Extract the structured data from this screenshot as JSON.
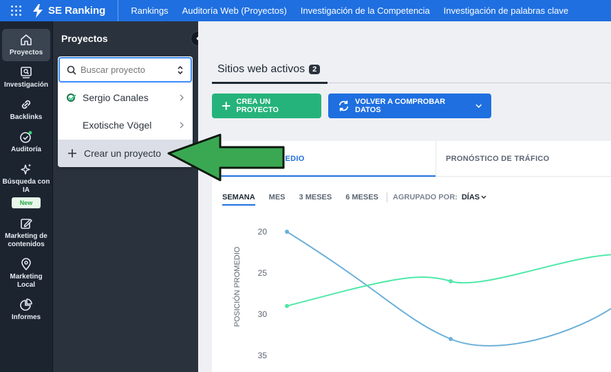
{
  "topbar": {
    "logo": "SE Ranking",
    "nav": [
      "Rankings",
      "Auditoría Web (Proyectos)",
      "Investigación de la Competencia",
      "Investigación de palabras clave"
    ]
  },
  "leftnav": {
    "items": [
      {
        "label": "Proyectos",
        "icon": "home-icon"
      },
      {
        "label": "Investigación",
        "icon": "research-icon"
      },
      {
        "label": "Backlinks",
        "icon": "link-icon"
      },
      {
        "label": "Auditoría",
        "icon": "audit-check-icon"
      },
      {
        "label": "Búsqueda con IA",
        "icon": "sparkle-icon"
      },
      {
        "label": "Marketing de contenidos",
        "icon": "edit-icon"
      },
      {
        "label": "Marketing Local",
        "icon": "location-pin-icon"
      },
      {
        "label": "Informes",
        "icon": "pie-chart-icon"
      }
    ],
    "new_badge": "New"
  },
  "projects_panel": {
    "title": "Proyectos",
    "search_placeholder": "Buscar proyecto",
    "projects": [
      "Sergio Canales",
      "Exotische Vögel"
    ],
    "create_label": "Crear un proyecto"
  },
  "main": {
    "tab_label": "Sitios web activos",
    "tab_count": "2",
    "create_button": "CREA UN PROYECTO",
    "recheck_button": "VOLVER A COMPROBAR DATOS",
    "metric_tab_1": "MEDIO",
    "metric_tab_2": "PRONÓSTICO DE TRÁFICO",
    "periods": [
      "SEMANA",
      "MES",
      "3 MESES",
      "6 MESES"
    ],
    "group_label": "AGRUPADO POR:",
    "group_value": "DÍAS"
  },
  "colors": {
    "accent": "#1f6fe0",
    "green": "#26b37b",
    "series_blue": "#6ab0d8",
    "series_green": "#4ee8a8",
    "arrow": "#3aa852"
  },
  "chart_data": {
    "type": "line",
    "ylabel": "POSICIÓN PROMEDIO",
    "y_ticks": [
      20,
      25,
      30,
      35
    ],
    "ylim": [
      20,
      35
    ],
    "y_inverted": true,
    "series": [
      {
        "values": [
          20,
          33
        ]
      },
      {
        "values": [
          29,
          26
        ]
      }
    ]
  }
}
